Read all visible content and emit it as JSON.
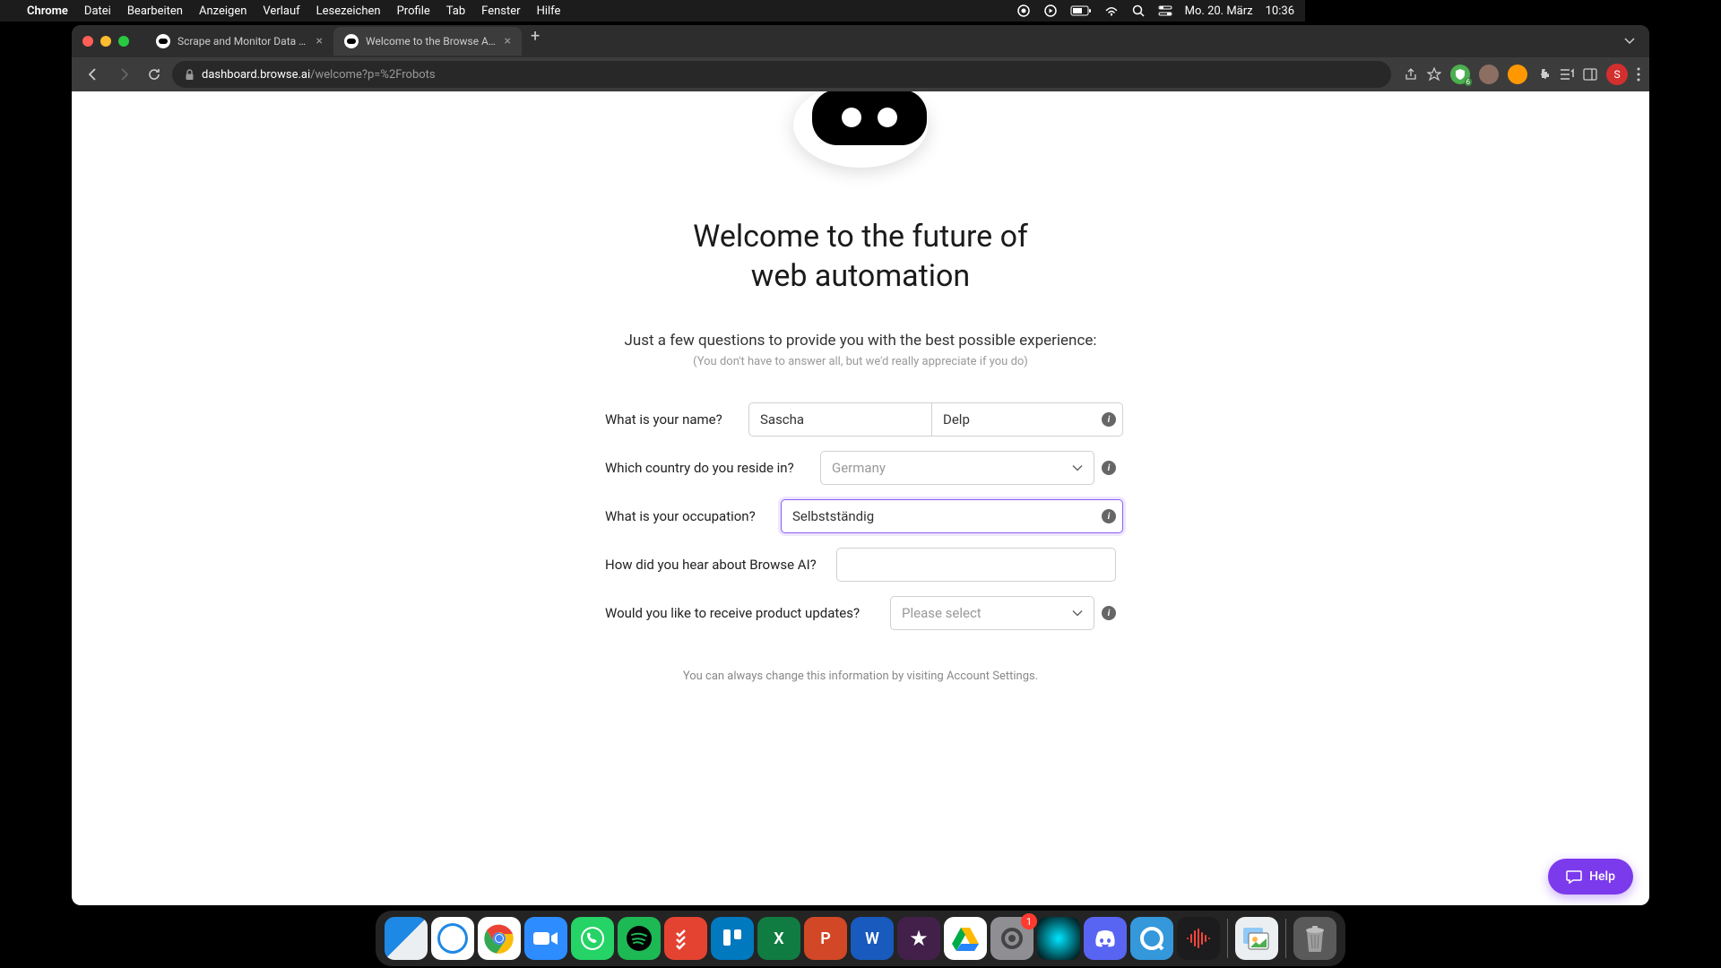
{
  "menubar": {
    "app": "Chrome",
    "items": [
      "Datei",
      "Bearbeiten",
      "Anzeigen",
      "Verlauf",
      "Lesezeichen",
      "Profile",
      "Tab",
      "Fenster",
      "Hilfe"
    ],
    "date": "Mo. 20. März",
    "time": "10:36"
  },
  "tabs": [
    {
      "title": "Scrape and Monitor Data from"
    },
    {
      "title": "Welcome to the Browse AI com"
    }
  ],
  "url": {
    "domain": "dashboard.browse.ai",
    "path": "/welcome?p=%2Frobots"
  },
  "profile_initial": "S",
  "ext_badge": "6",
  "page": {
    "headline_l1": "Welcome to the future of",
    "headline_l2": "web automation",
    "subtitle": "Just a few questions to provide you with the best possible experience:",
    "subtitle_note": "(You don't have to answer all, but we'd really appreciate if you do)",
    "labels": {
      "name": "What is your name?",
      "country": "Which country do you reside in?",
      "occupation": "What is your occupation?",
      "heard": "How did you hear about Browse AI?",
      "updates": "Would you like to receive product updates?"
    },
    "values": {
      "first_name": "Sascha",
      "last_name": "Delp",
      "country_placeholder": "Germany",
      "occupation": "Selbstständig ",
      "updates_placeholder": "Please select"
    },
    "footer": "You can always change this information by visiting Account Settings.",
    "help": "Help"
  },
  "dock_badge": "1"
}
